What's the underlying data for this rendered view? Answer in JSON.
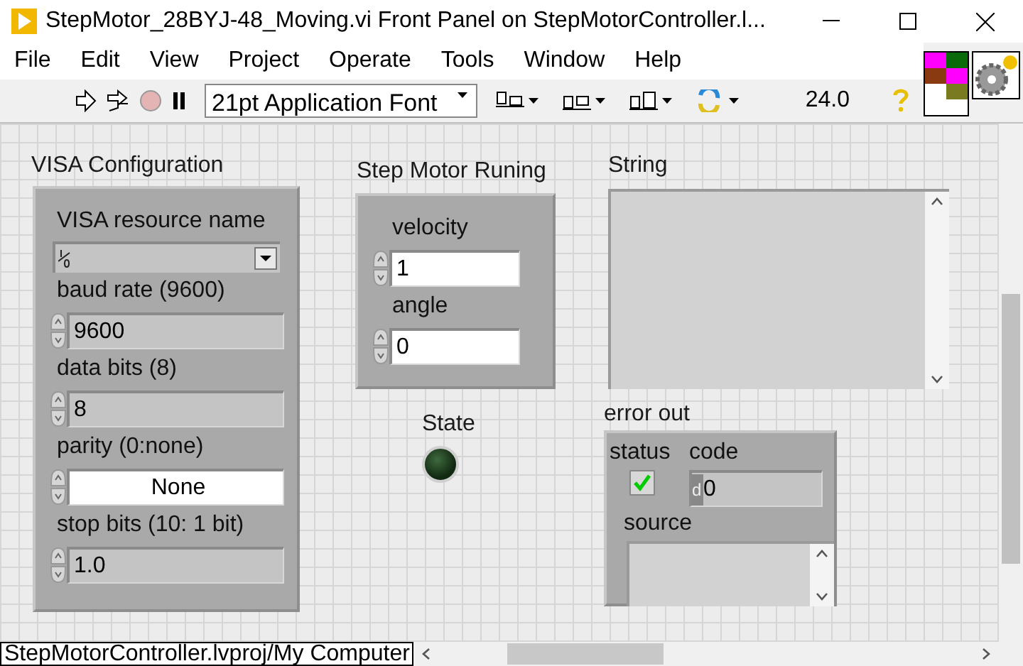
{
  "window": {
    "title": "StepMotor_28BYJ-48_Moving.vi Front Panel on StepMotorController.l..."
  },
  "menu": [
    "File",
    "Edit",
    "View",
    "Project",
    "Operate",
    "Tools",
    "Window",
    "Help"
  ],
  "toolbar": {
    "font": "21pt Application Font",
    "zoom": "24.0"
  },
  "visa_configuration": {
    "label": "VISA Configuration",
    "controls": [
      {
        "kind": "ring",
        "label": "VISA resource name"
      },
      {
        "kind": "numeric",
        "label": "baud rate (9600)",
        "value": "9600"
      },
      {
        "kind": "numeric",
        "label": "data bits (8)",
        "value": "8"
      },
      {
        "kind": "enum",
        "label": "parity (0:none)",
        "value": "None"
      },
      {
        "kind": "numeric",
        "label": "stop bits (10: 1 bit)",
        "value": "1.0"
      }
    ]
  },
  "step_motor": {
    "label": "Step Motor Runing",
    "controls": [
      {
        "label": "velocity",
        "value": "1"
      },
      {
        "label": "angle",
        "value": "0"
      }
    ]
  },
  "state": {
    "label": "State",
    "on": false
  },
  "string": {
    "label": "String"
  },
  "error_out": {
    "label": "error out",
    "status": {
      "label": "status",
      "checked": true
    },
    "code": {
      "label": "code",
      "radix": "d",
      "value": "0"
    },
    "source": {
      "label": "source"
    }
  },
  "status_bar": {
    "path": "StepMotorController.lvproj/My Computer"
  }
}
